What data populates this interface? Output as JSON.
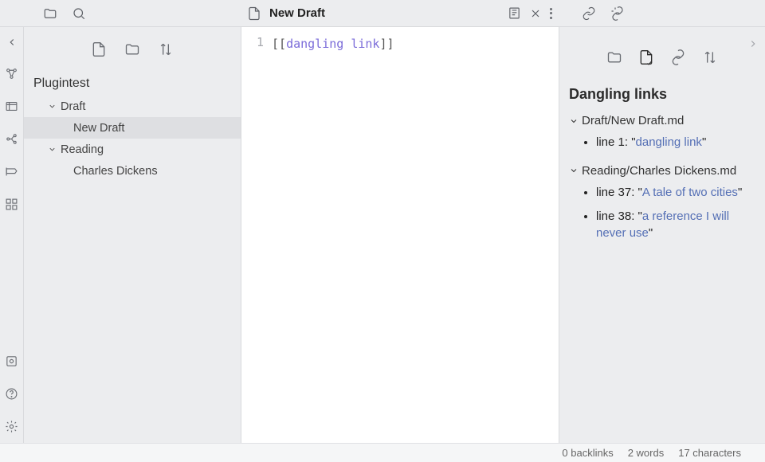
{
  "titlebar": {
    "tab_title": "New Draft"
  },
  "left": {
    "vault": "Plugintest",
    "tree": [
      {
        "label": "Draft",
        "level": 1,
        "expandable": true
      },
      {
        "label": "New Draft",
        "level": 2,
        "selected": true
      },
      {
        "label": "Reading",
        "level": 1,
        "expandable": true
      },
      {
        "label": "Charles Dickens",
        "level": 2
      }
    ]
  },
  "editor": {
    "line_no": "1",
    "bracket_open": "[[",
    "link_text": "dangling link",
    "bracket_close": "]]"
  },
  "right": {
    "title": "Dangling links",
    "sections": [
      {
        "file": "Draft/New Draft.md",
        "items": [
          {
            "prefix": "line 1: \"",
            "link": "dangling link",
            "suffix": "\""
          }
        ]
      },
      {
        "file": "Reading/Charles Dickens.md",
        "items": [
          {
            "prefix": "line 37: \"",
            "link": "A tale of two cities",
            "suffix": "\""
          },
          {
            "prefix": "line 38: \"",
            "link": "a reference I will never use",
            "suffix": "\""
          }
        ]
      }
    ]
  },
  "status": {
    "backlinks": "0 backlinks",
    "words": "2 words",
    "chars": "17 characters"
  }
}
